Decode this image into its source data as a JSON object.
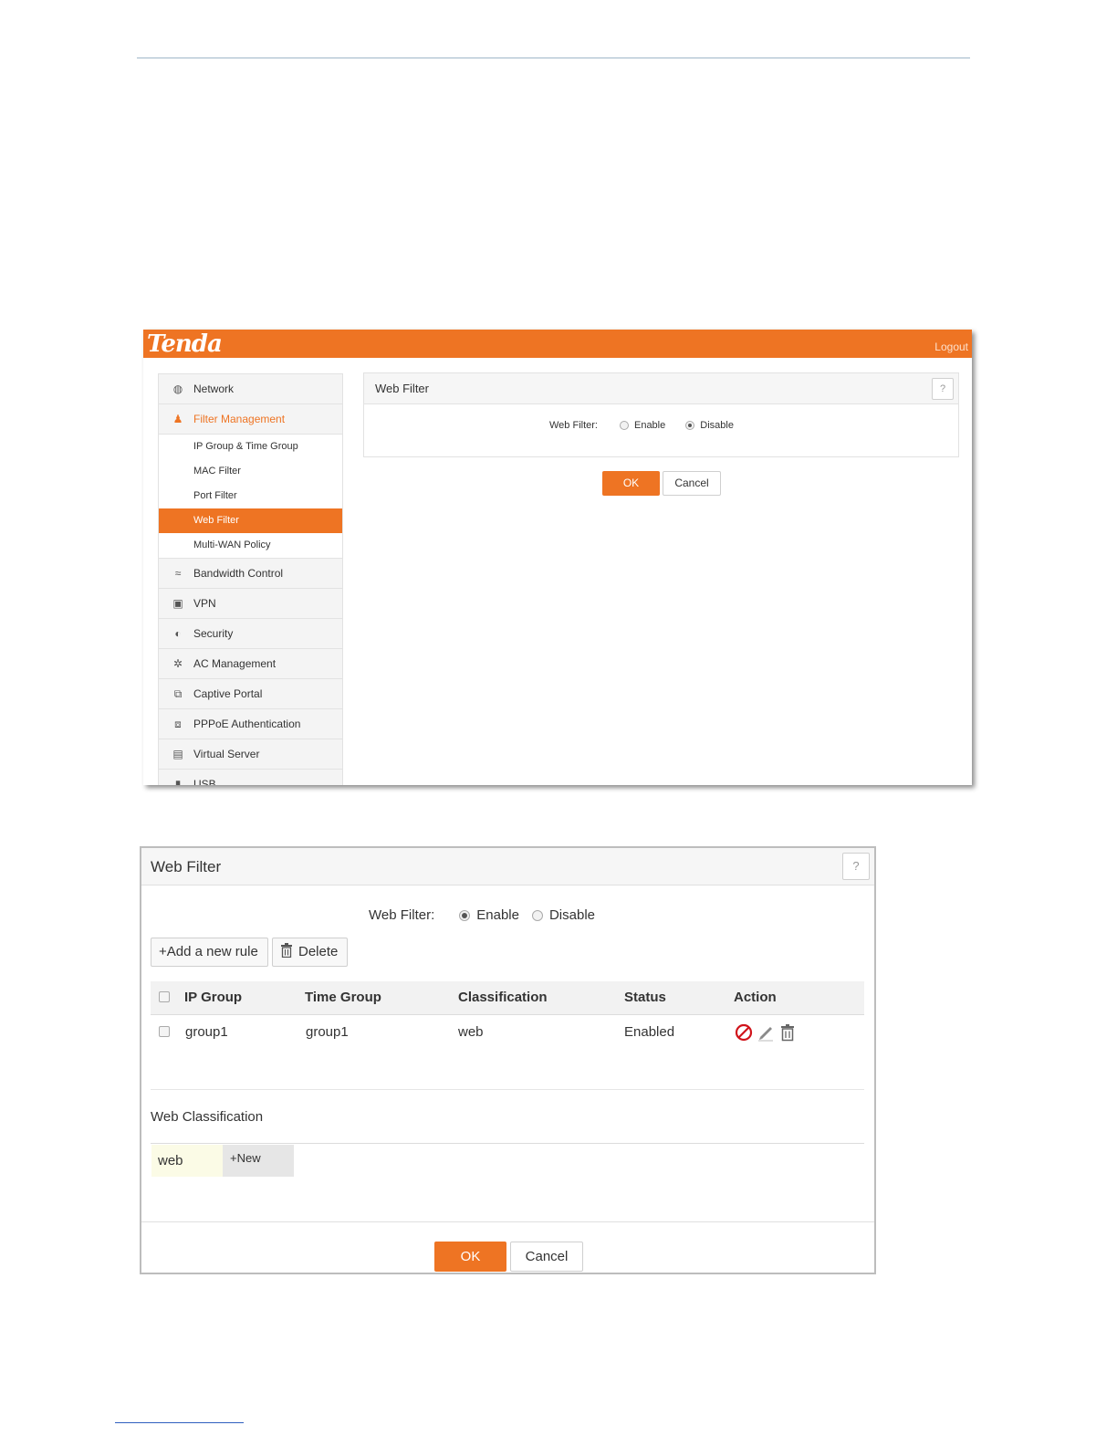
{
  "screenshot1": {
    "logo": "Tenda",
    "logout": "Logout",
    "nav": [
      {
        "label": "Network",
        "icon": "globe-icon"
      },
      {
        "label": "Filter Management",
        "icon": "filter-user-icon"
      },
      {
        "label": "Bandwidth Control",
        "icon": "chart-line-icon"
      },
      {
        "label": "VPN",
        "icon": "monitor-icon"
      },
      {
        "label": "Security",
        "icon": "shield-icon"
      },
      {
        "label": "AC Management",
        "icon": "wrench-icon"
      },
      {
        "label": "Captive Portal",
        "icon": "portal-icon"
      },
      {
        "label": "PPPoE Authentication",
        "icon": "authentication-icon"
      },
      {
        "label": "Virtual Server",
        "icon": "server-icon"
      },
      {
        "label": "USB",
        "icon": "usb-icon"
      }
    ],
    "subnav": [
      "IP Group & Time Group",
      "MAC Filter",
      "Port Filter",
      "Web Filter",
      "Multi-WAN Policy"
    ],
    "selected_subnav": "Web Filter",
    "panel": {
      "title": "Web Filter",
      "help": "?",
      "field_label": "Web Filter:",
      "enable": "Enable",
      "disable": "Disable",
      "selected": "Disable"
    },
    "ok": "OK",
    "cancel": "Cancel",
    "accent_color": "#ee7423"
  },
  "screenshot2": {
    "title": "Web Filter",
    "help": "?",
    "field_label": "Web Filter:",
    "enable": "Enable",
    "disable": "Disable",
    "selected": "Enable",
    "add_rule": "+Add a new rule",
    "delete": "Delete",
    "columns": [
      "IP Group",
      "Time Group",
      "Classification",
      "Status",
      "Action"
    ],
    "rows": [
      {
        "ip_group": "group1",
        "time_group": "group1",
        "classification": "web",
        "status": "Enabled"
      }
    ],
    "classification_title": "Web Classification",
    "classification_tag": "web",
    "new_button": "+New",
    "ok": "OK",
    "cancel": "Cancel"
  }
}
